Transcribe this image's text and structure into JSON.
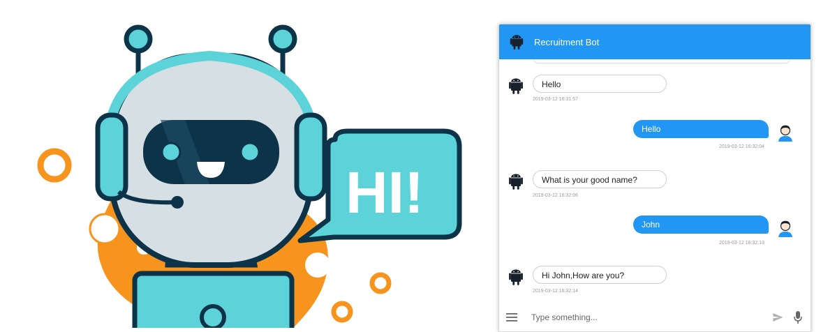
{
  "illustration": {
    "speech_text": "HI!"
  },
  "chat": {
    "title": "Recruitment Bot",
    "messages": [
      {
        "from": "bot",
        "text": "Hello",
        "time": "2019-03-12 16:31:57"
      },
      {
        "from": "user",
        "text": "Hello",
        "time": "2019-03-12 16:32:04"
      },
      {
        "from": "bot",
        "text": "What is your good name?",
        "time": "2019-03-12 16:32:06"
      },
      {
        "from": "user",
        "text": "John",
        "time": "2019-03-12 16:32:13"
      },
      {
        "from": "bot",
        "text": "Hi John,How are you?",
        "time": "2019-03-12 16:32:14"
      }
    ],
    "input": {
      "placeholder": "Type something...",
      "value": ""
    }
  },
  "colors": {
    "header": "#2196f3",
    "user_bubble": "#2196f3",
    "robot_teal": "#5cd3d8",
    "accent_orange": "#f7941d",
    "outline": "#0d3349"
  },
  "icons": {
    "bot": "android-icon",
    "user": "user-avatar-icon",
    "menu": "menu-icon",
    "send": "send-icon",
    "mic": "mic-icon"
  }
}
